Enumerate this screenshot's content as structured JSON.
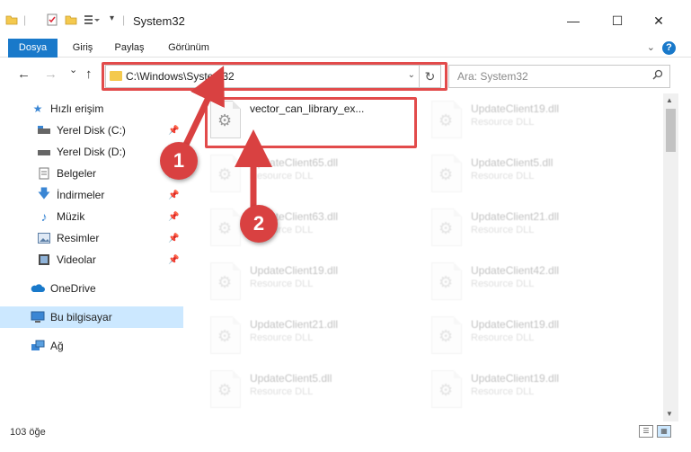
{
  "window": {
    "title": "System32",
    "minimize_glyph": "—",
    "maximize_glyph": "☐",
    "close_glyph": "✕"
  },
  "quick_access": {
    "icons": [
      "folder-icon",
      "properties-icon",
      "new-folder-icon",
      "customize-icon"
    ]
  },
  "ribbon": {
    "tabs": [
      {
        "label": "Dosya",
        "active": true
      },
      {
        "label": "Giriş",
        "active": false
      },
      {
        "label": "Paylaş",
        "active": false
      },
      {
        "label": "Görünüm",
        "active": false
      }
    ],
    "help": "?"
  },
  "nav": {
    "back": "←",
    "forward": "→",
    "recent": "⌄",
    "up": "↑",
    "address": "C:\\Windows\\System32",
    "refresh": "↻",
    "search_placeholder": "Ara: System32",
    "search_icon": "⌕"
  },
  "sidebar": {
    "items": [
      {
        "label": "Hızlı erişim",
        "icon": "star-icon",
        "pinned": false
      },
      {
        "label": "Yerel Disk (C:)",
        "icon": "drive-icon",
        "pinned": true
      },
      {
        "label": "Yerel Disk (D:)",
        "icon": "drive-icon",
        "pinned": true
      },
      {
        "label": "Belgeler",
        "icon": "documents-icon",
        "pinned": true
      },
      {
        "label": "İndirmeler",
        "icon": "downloads-icon",
        "pinned": true
      },
      {
        "label": "Müzik",
        "icon": "music-icon",
        "pinned": true
      },
      {
        "label": "Resimler",
        "icon": "pictures-icon",
        "pinned": true
      },
      {
        "label": "Videolar",
        "icon": "videos-icon",
        "pinned": true
      },
      {
        "label": "OneDrive",
        "icon": "cloud-icon",
        "pinned": false
      },
      {
        "label": "Bu bilgisayar",
        "icon": "computer-icon",
        "pinned": false,
        "selected": true
      },
      {
        "label": "Ağ",
        "icon": "network-icon",
        "pinned": false
      }
    ]
  },
  "files": [
    {
      "name": "vector_can_library_ex...",
      "desc": ""
    },
    {
      "name": "UpdateClient19.dll",
      "desc": "Resource DLL"
    },
    {
      "name": "UpdateClient65.dll",
      "desc": "Resource DLL"
    },
    {
      "name": "UpdateClient5.dll",
      "desc": "Resource DLL"
    },
    {
      "name": "UpdateClient63.dll",
      "desc": "Resource DLL"
    },
    {
      "name": "UpdateClient21.dll",
      "desc": "Resource DLL"
    },
    {
      "name": "UpdateClient19.dll",
      "desc": "Resource DLL"
    },
    {
      "name": "UpdateClient42.dll",
      "desc": "Resource DLL"
    },
    {
      "name": "UpdateClient21.dll",
      "desc": "Resource DLL"
    },
    {
      "name": "UpdateClient19.dll",
      "desc": "Resource DLL"
    },
    {
      "name": "UpdateClient5.dll",
      "desc": "Resource DLL"
    },
    {
      "name": "UpdateClient19.dll",
      "desc": "Resource DLL"
    }
  ],
  "status": {
    "count": "103 öğe"
  },
  "callouts": [
    "1",
    "2"
  ],
  "colors": {
    "accent": "#1979ca",
    "highlight": "#e24b4b",
    "selection": "#cce8ff"
  }
}
